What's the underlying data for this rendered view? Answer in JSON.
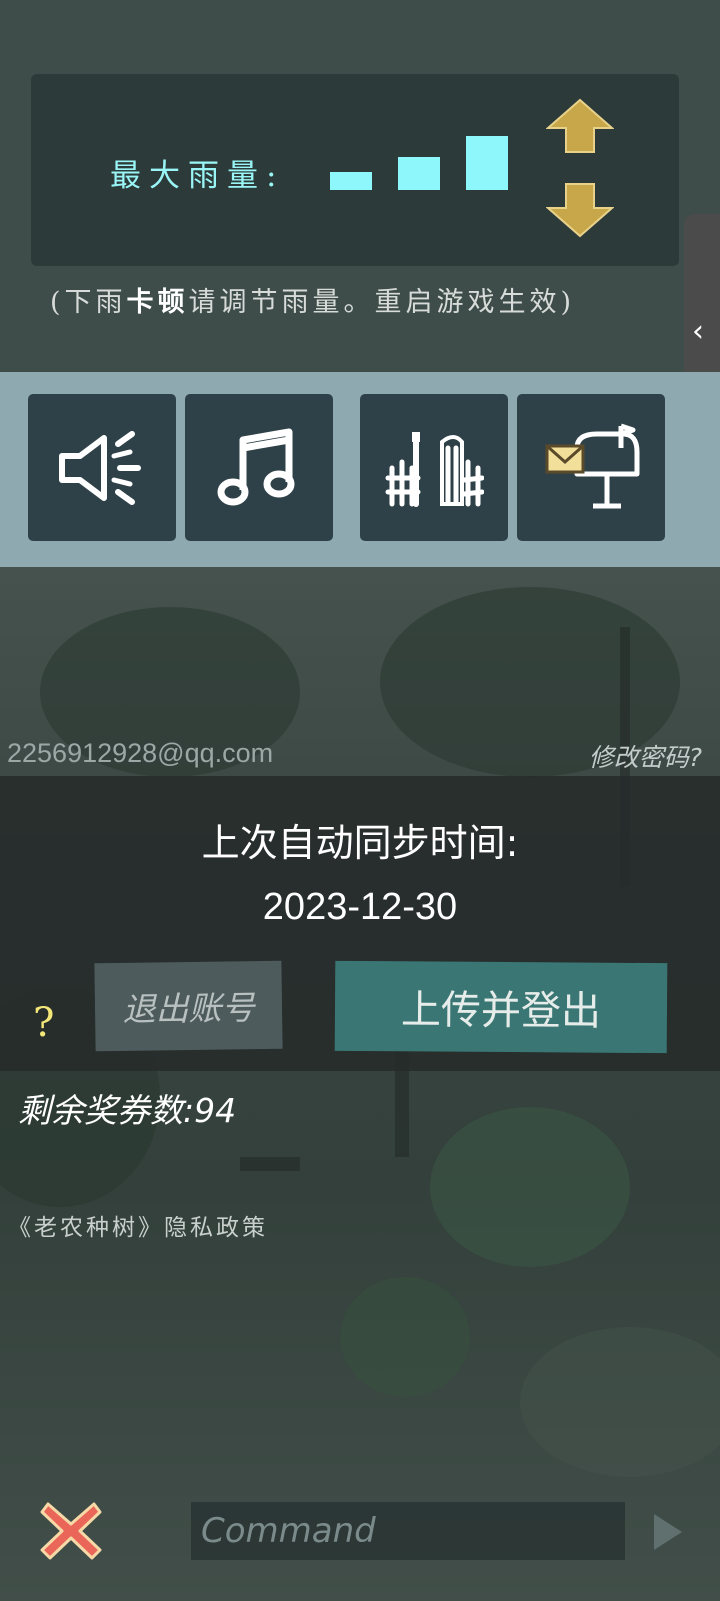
{
  "rain_settings": {
    "label": "最大雨量:",
    "hint_prefix": "(下雨",
    "hint_bold": "卡顿",
    "hint_suffix": "请调节雨量。重启游戏生效)",
    "bar_color": "#8ef7fb",
    "arrow_color": "#c8a64a"
  },
  "toolbar": {
    "buttons": [
      {
        "icon": "speaker-icon"
      },
      {
        "icon": "music-note-icon"
      },
      {
        "icon": "fence-gate-icon"
      },
      {
        "icon": "mailbox-icon"
      }
    ]
  },
  "account": {
    "email": "2256912928@qq.com",
    "change_password": "修改密码?"
  },
  "sync": {
    "title": "上次自动同步时间:",
    "date": "2023-12-30",
    "help": "?",
    "logout_label": "退出账号",
    "upload_logout_label": "上传并登出"
  },
  "coupons_text": "剩余奖券数:94",
  "privacy_link": "《老农种树》隐私政策",
  "command": {
    "placeholder": "Command"
  },
  "side_tab": {
    "glyph": "‹"
  },
  "colors": {
    "accent_teal": "#3a7774",
    "panel_dark": "#2c3a3a",
    "icon_bar": "#8eaab0",
    "help_yellow": "#f3e77a"
  }
}
